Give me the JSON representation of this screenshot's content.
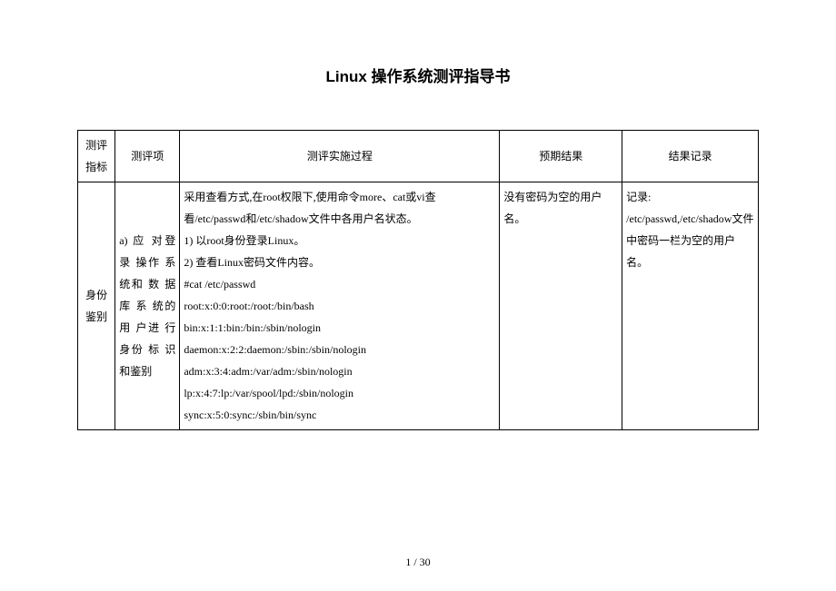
{
  "title": "Linux 操作系统测评指导书",
  "headers": {
    "col1": "测评指标",
    "col2": "测评项",
    "col3": "测评实施过程",
    "col4": "预期结果",
    "col5": "结果记录"
  },
  "row": {
    "indicator": "身份鉴别",
    "item": "a) 应 对登 录 操作 系 统和 数 据库 系 统的 用 户进 行 身份 标 识和鉴别",
    "process": "采用查看方式,在root权限下,使用命令more、cat或vi查看/etc/passwd和/etc/shadow文件中各用户名状态。\n1)  以root身份登录Linux。\n2)  查看Linux密码文件内容。\n#cat /etc/passwd\nroot:x:0:0:root:/root:/bin/bash\nbin:x:1:1:bin:/bin:/sbin/nologin\ndaemon:x:2:2:daemon:/sbin:/sbin/nologin\nadm:x:3:4:adm:/var/adm:/sbin/nologin\nlp:x:4:7:lp:/var/spool/lpd:/sbin/nologin\nsync:x:5:0:sync:/sbin/bin/sync",
    "expected": "没有密码为空的用户名。",
    "record": "记录:\n/etc/passwd,/etc/shadow文件中密码一栏为空的用户名。"
  },
  "footer": "1 / 30"
}
